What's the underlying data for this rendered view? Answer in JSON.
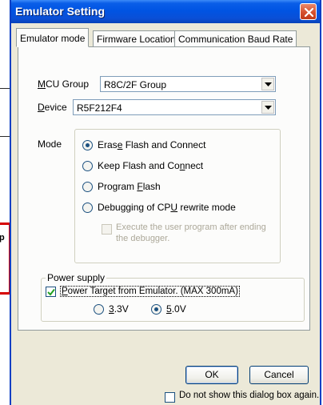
{
  "window": {
    "title": "Emulator Setting"
  },
  "tabs": [
    {
      "label": "Emulator mode",
      "active": true
    },
    {
      "label": "Firmware Location",
      "active": false
    },
    {
      "label": "Communication Baud Rate",
      "active": false
    }
  ],
  "mcu_group": {
    "label_hot": "M",
    "label_rest": "CU Group",
    "value": "R8C/2F Group"
  },
  "device": {
    "label_hot": "D",
    "label_rest": "evice",
    "value": "R5F212F4"
  },
  "mode": {
    "label": "Mode",
    "options": [
      {
        "pre": "Eras",
        "hot": "e",
        "post": " Flash and Connect",
        "selected": true
      },
      {
        "pre": "Keep Flash and Co",
        "hot": "n",
        "post": "nect",
        "selected": false
      },
      {
        "pre": "Program ",
        "hot": "F",
        "post": "lash",
        "selected": false
      },
      {
        "pre": "Debugging of CP",
        "hot": "U",
        "post": " rewrite mode",
        "selected": false
      }
    ],
    "execute_option": {
      "line1": "Execute the user program after ending",
      "line2": "the debugger.",
      "checked": false,
      "enabled": false
    }
  },
  "power_supply": {
    "label": "Power supply",
    "power_target": {
      "hot": "P",
      "rest": "ower Target from Emulator. (MAX 300mA)",
      "checked": true
    },
    "voltages": [
      {
        "hot": "3",
        "rest": ".3V",
        "selected": false
      },
      {
        "hot": "5",
        "rest": ".0V",
        "selected": true
      }
    ]
  },
  "buttons": {
    "ok": "OK",
    "cancel": "Cancel"
  },
  "footer": {
    "dont_show": "Do not show this dialog box again.",
    "checked": false
  },
  "overlay": {
    "fragment": "p"
  },
  "colors": {
    "titlebar": "#0054e3",
    "dialog_bg": "#ece9d8",
    "annotation_red": "#d60000"
  }
}
